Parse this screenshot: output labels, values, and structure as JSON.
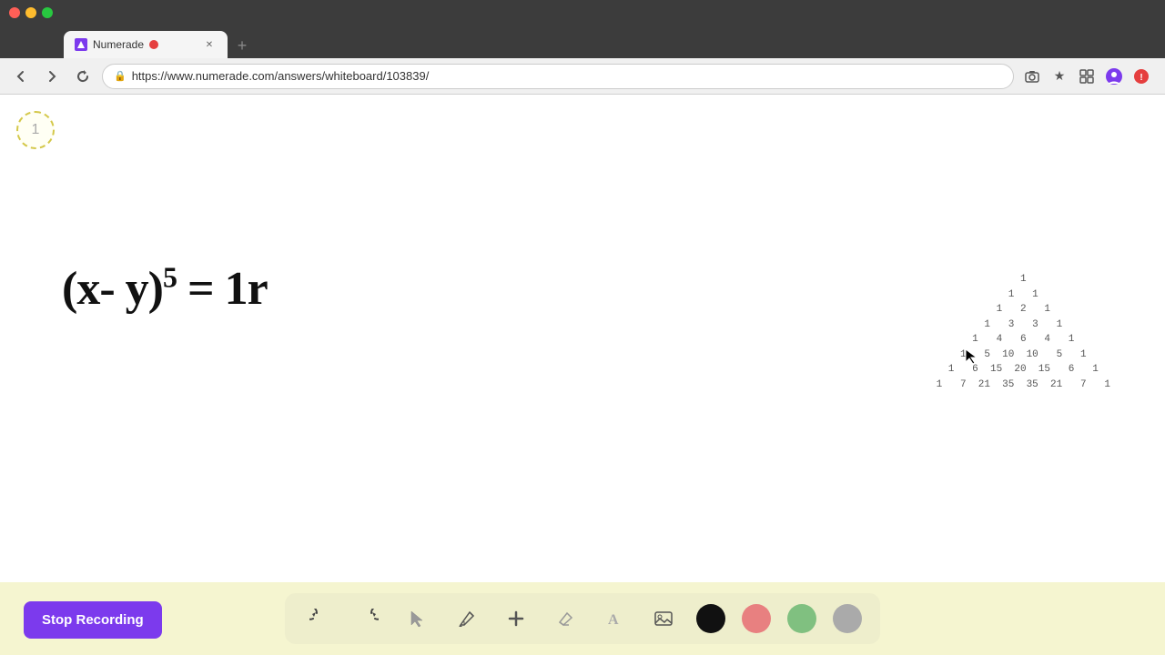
{
  "browser": {
    "title": "Numerade",
    "url": "https://www.numerade.com/answers/whiteboard/103839/",
    "tab_label": "Numerade",
    "tab_new_label": "+",
    "nav": {
      "back": "‹",
      "forward": "›",
      "refresh": "↻"
    }
  },
  "whiteboard": {
    "slide_number": "1",
    "math_equation": "(x- y)⁵ = 1r",
    "pascals_triangle": {
      "rows": [
        "1",
        "1   1",
        "1   2   1",
        "1   3   3   1",
        "1   4   6   4   1",
        "1   5  10  10   5   1",
        "1   6  15  20  15   6   1",
        "1   7  21  35  35  21   7   1"
      ]
    }
  },
  "toolbar": {
    "tools": [
      {
        "name": "undo",
        "icon": "↺"
      },
      {
        "name": "redo",
        "icon": "↻"
      },
      {
        "name": "select",
        "icon": "↖"
      },
      {
        "name": "pen",
        "icon": "✏"
      },
      {
        "name": "add",
        "icon": "+"
      },
      {
        "name": "eraser",
        "icon": "◻"
      },
      {
        "name": "text",
        "icon": "A"
      },
      {
        "name": "image",
        "icon": "🖼"
      }
    ],
    "colors": [
      {
        "name": "black",
        "value": "#111111"
      },
      {
        "name": "pink",
        "value": "#e88080"
      },
      {
        "name": "green",
        "value": "#80c080"
      },
      {
        "name": "gray",
        "value": "#aaaaaa"
      }
    ]
  },
  "stop_recording": {
    "label": "Stop Recording"
  }
}
